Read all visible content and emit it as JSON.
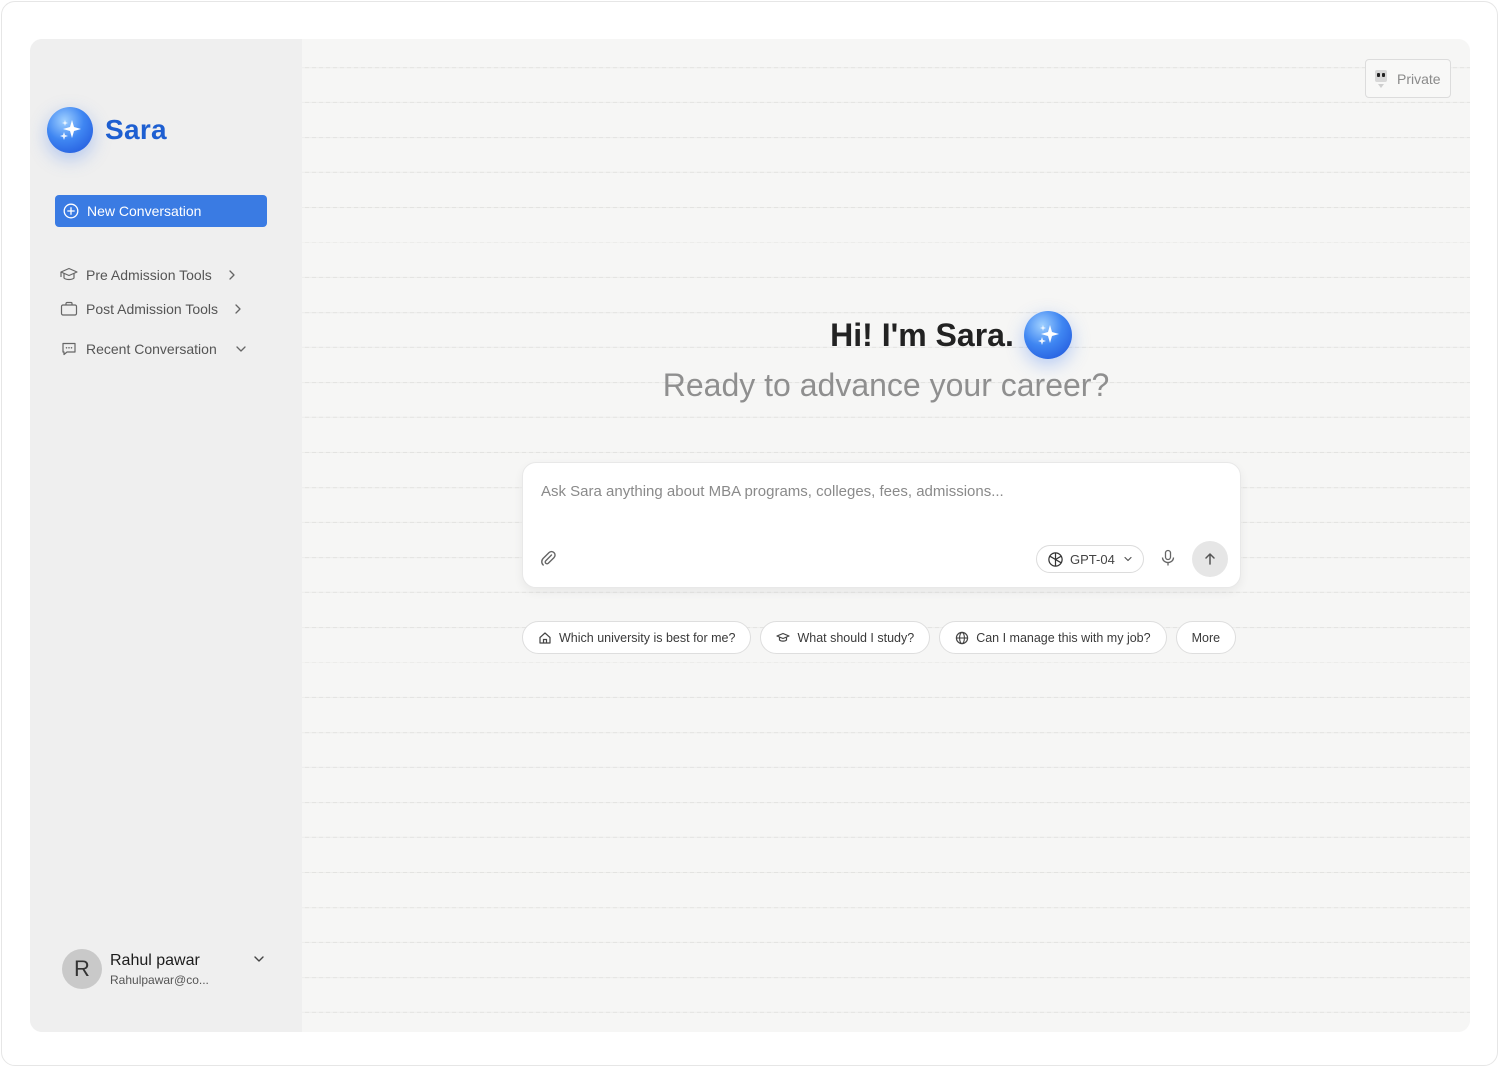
{
  "brand": {
    "name": "Sara"
  },
  "sidebar": {
    "new_conversation_label": "New Conversation",
    "items": [
      {
        "label": "Pre Admission Tools",
        "icon": "graduation-cap-icon"
      },
      {
        "label": "Post Admission Tools",
        "icon": "briefcase-icon"
      },
      {
        "label": "Recent Conversation",
        "icon": "chat-icon"
      }
    ],
    "user": {
      "initial": "R",
      "name": "Rahul pawar",
      "email": "Rahulpawar@co..."
    }
  },
  "header": {
    "private_label": "Private"
  },
  "hero": {
    "greeting": "Hi! I'm Sara.",
    "tagline": "Ready to advance your career?"
  },
  "composer": {
    "placeholder": "Ask Sara anything about MBA programs, colleges, fees, admissions...",
    "value": "",
    "model": "GPT-04"
  },
  "suggestions": [
    {
      "label": "Which university is best for me?",
      "icon": "home-icon"
    },
    {
      "label": "What should I study?",
      "icon": "graduation-cap-icon"
    },
    {
      "label": "Can I manage this with my job?",
      "icon": "globe-icon"
    },
    {
      "label": "More",
      "icon": ""
    }
  ],
  "colors": {
    "accent": "#3a7be3",
    "brand": "#1e5fd1",
    "sidebar_bg": "#efefef",
    "main_bg": "#f6f6f5"
  }
}
